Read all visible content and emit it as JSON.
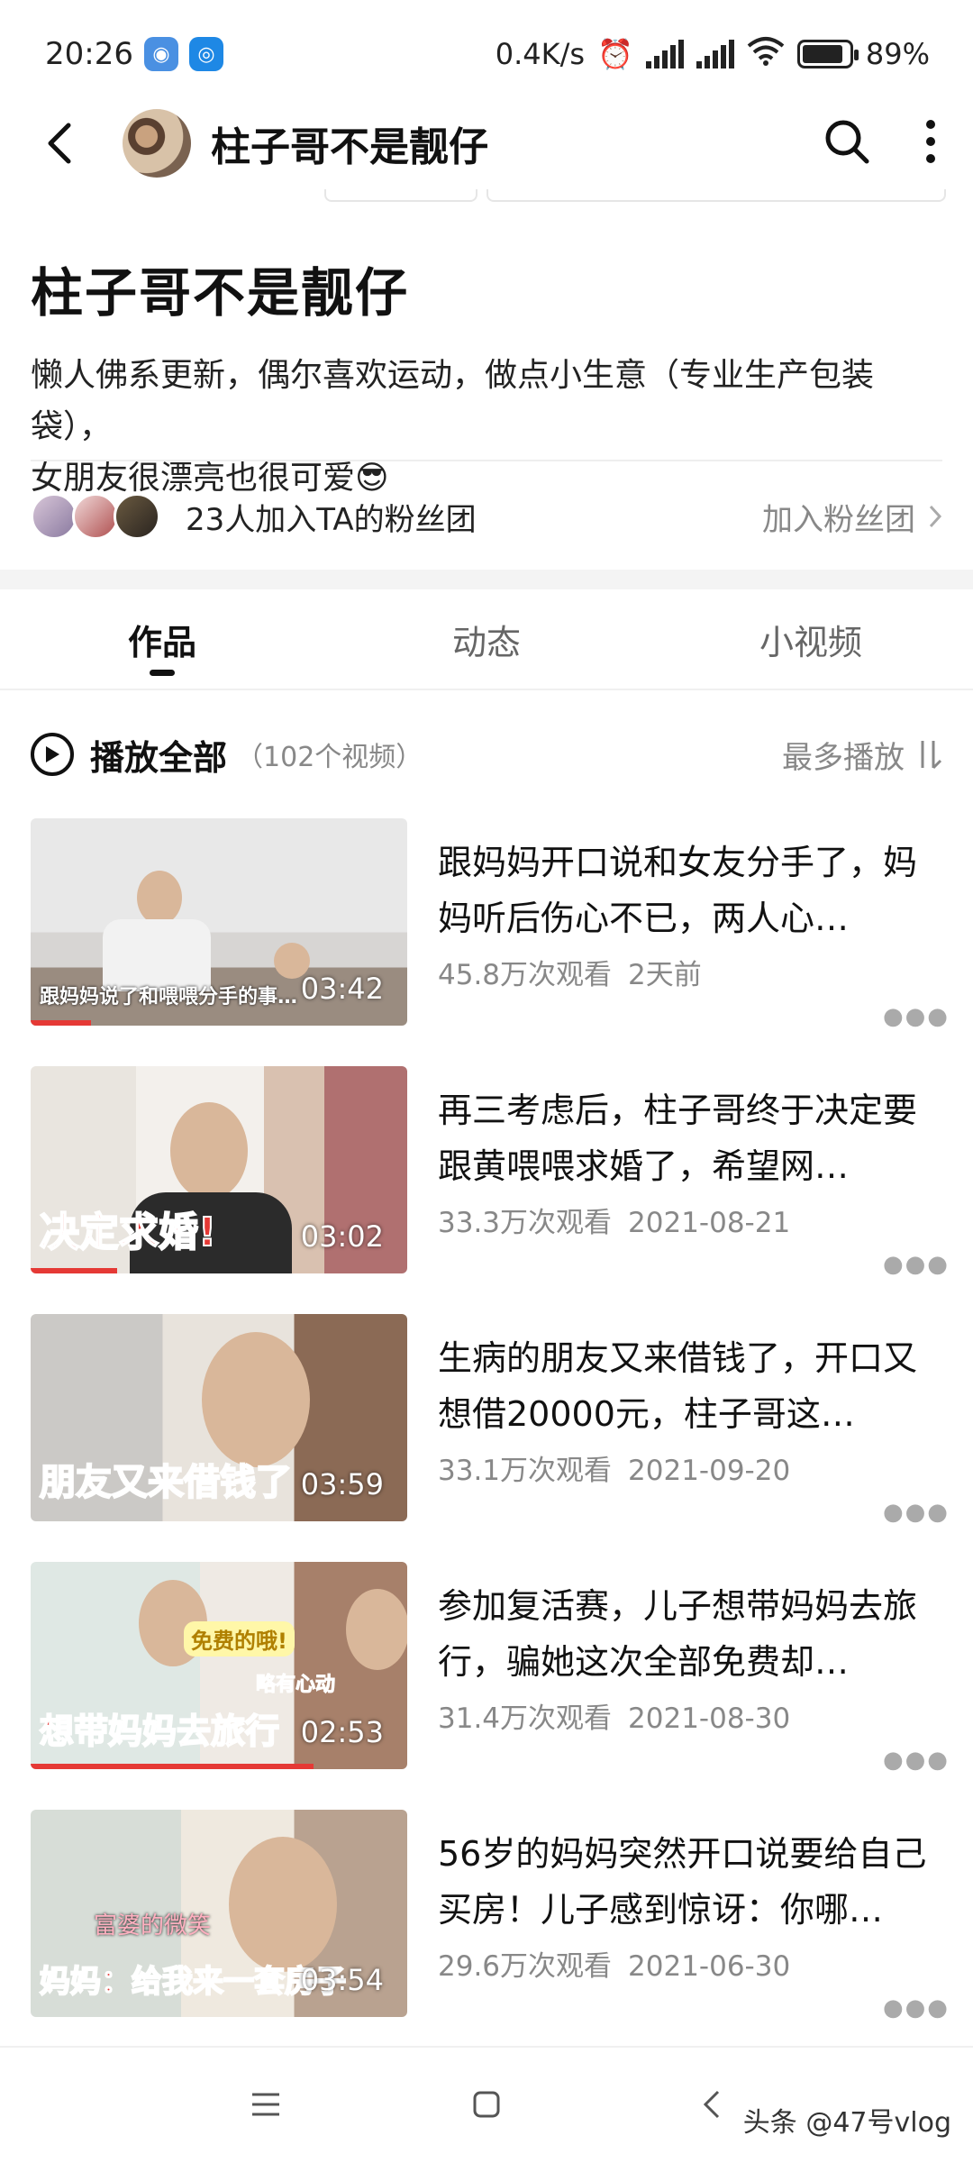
{
  "status_bar": {
    "time": "20:26",
    "net_speed": "0.4K/s",
    "battery_percent": "89%",
    "battery_level": 0.89
  },
  "header": {
    "title": "柱子哥不是靓仔",
    "icons": [
      "back-icon",
      "search-icon",
      "more-vertical-icon"
    ]
  },
  "profile": {
    "name": "柱子哥不是靓仔",
    "bio_line1": "懒人佛系更新，偶尔喜欢运动，做点小生意（专业生产包装袋），",
    "bio_line2": "女朋友很漂亮也很可爱😎"
  },
  "fans": {
    "text": "23人加入TA的粉丝团",
    "join_label": "加入粉丝团"
  },
  "tabs": [
    {
      "label": "作品",
      "active": true
    },
    {
      "label": "动态",
      "active": false
    },
    {
      "label": "小视频",
      "active": false
    }
  ],
  "playall": {
    "label": "播放全部",
    "count": "（102个视频）",
    "sort_label": "最多播放"
  },
  "videos": [
    {
      "title": "跟妈妈开口说和女友分手了，妈妈听后伤心不已，两人心…",
      "views": "45.8万次观看",
      "date": "2天前",
      "duration": "03:42",
      "thumb_caption": "跟妈妈说了和喂喂分手的事…",
      "progress": 0.16
    },
    {
      "title": "再三考虑后，柱子哥终于决定要跟黄喂喂求婚了，希望网…",
      "views": "33.3万次观看",
      "date": "2021-08-21",
      "duration": "03:02",
      "thumb_caption": "决定求婚!",
      "progress": 0.23
    },
    {
      "title": "生病的朋友又来借钱了，开口又想借20000元，柱子哥这…",
      "views": "33.1万次观看",
      "date": "2021-09-20",
      "duration": "03:59",
      "thumb_caption": "朋友又来借钱了",
      "progress": 0
    },
    {
      "title": "参加复活赛，儿子想带妈妈去旅行，骗她这次全部免费却…",
      "views": "31.4万次观看",
      "date": "2021-08-30",
      "duration": "02:53",
      "thumb_caption": "想带妈妈去旅行",
      "thumb_bubble1": "免费的哦!",
      "thumb_bubble2": "略有心动",
      "progress": 0.75
    },
    {
      "title": "56岁的妈妈突然开口说要给自己买房！儿子感到惊讶：你哪…",
      "views": "29.6万次观看",
      "date": "2021-06-30",
      "duration": "03:54",
      "thumb_caption": "妈妈：给我来一套房子",
      "thumb_bubble1": "富婆的微笑",
      "progress": 0
    }
  ],
  "watermark": "头条 @47号vlog"
}
